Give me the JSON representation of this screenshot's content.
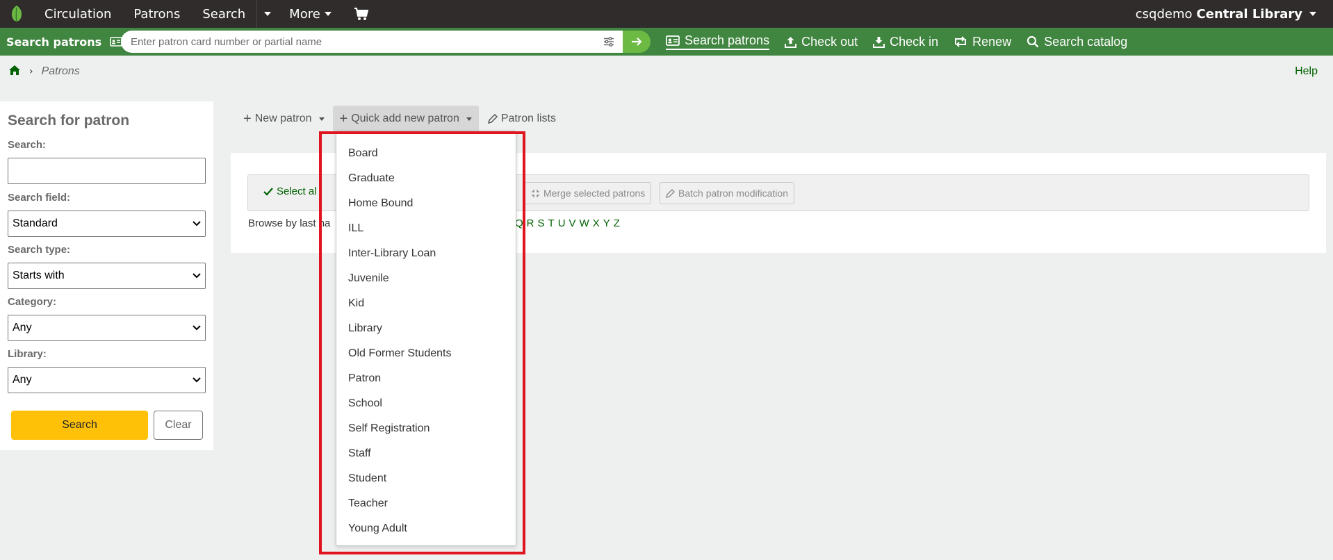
{
  "topnav": {
    "items": [
      "Circulation",
      "Patrons",
      "Search",
      "More"
    ],
    "user": "csqdemo",
    "library": "Central Library"
  },
  "searchbar": {
    "label": "Search patrons",
    "placeholder": "Enter patron card number or partial name",
    "links": [
      "Search patrons",
      "Check out",
      "Check in",
      "Renew",
      "Search catalog"
    ]
  },
  "breadcrumb": {
    "current": "Patrons"
  },
  "help": "Help",
  "sidebar": {
    "title": "Search for patron",
    "search_label": "Search:",
    "search_value": "",
    "field_label": "Search field:",
    "field_value": "Standard",
    "type_label": "Search type:",
    "type_value": "Starts with",
    "category_label": "Category:",
    "category_value": "Any",
    "library_label": "Library:",
    "library_value": "Any",
    "search_button": "Search",
    "clear_button": "Clear"
  },
  "toolbar": {
    "new_patron": "New patron",
    "quick_add": "Quick add new patron",
    "patron_lists": "Patron lists"
  },
  "actions": {
    "select_all": "Select al",
    "merge": "Merge selected patrons",
    "batch": "Batch patron modification"
  },
  "browse": {
    "label": "Browse by last na",
    "letters": [
      "Q",
      "R",
      "S",
      "T",
      "U",
      "V",
      "W",
      "X",
      "Y",
      "Z"
    ]
  },
  "dropdown": {
    "items": [
      "Board",
      "Graduate",
      "Home Bound",
      "ILL",
      "Inter-Library Loan",
      "Juvenile",
      "Kid",
      "Library",
      "Old Former Students",
      "Patron",
      "School",
      "Self Registration",
      "Staff",
      "Student",
      "Teacher",
      "Young Adult"
    ]
  },
  "colors": {
    "topnav": "#302c2c",
    "searchbar": "#408540",
    "accent_green": "#006100",
    "search_button": "#ffc107",
    "highlight": "#e0141e"
  }
}
